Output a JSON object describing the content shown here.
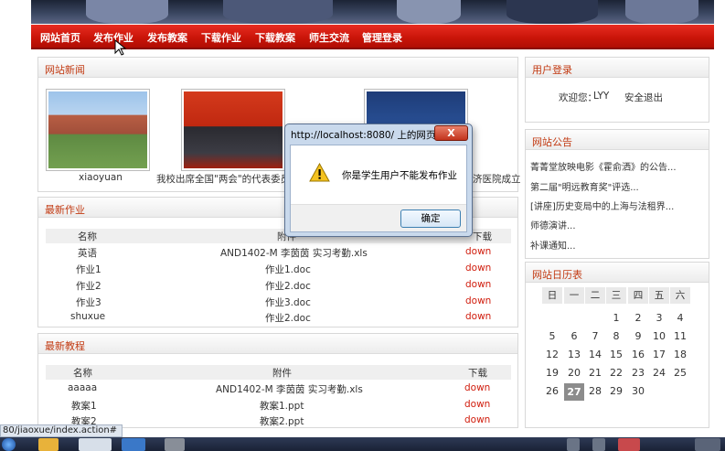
{
  "nav": [
    "网站首页",
    "发布作业",
    "发布教案",
    "下载作业",
    "下载教案",
    "师生交流",
    "管理登录"
  ],
  "news": {
    "title": "网站新闻",
    "captions": [
      "xiaoyuan",
      "我校出席全国\"两会\"的代表委员载",
      "济医院成立"
    ]
  },
  "homework": {
    "title": "最新作业",
    "headers": [
      "名称",
      "附件",
      "下载"
    ],
    "rows": [
      [
        "英语",
        "AND1402-M 李茵茵 实习考勤.xls",
        "down"
      ],
      [
        "作业1",
        "作业1.doc",
        "down"
      ],
      [
        "作业2",
        "作业2.doc",
        "down"
      ],
      [
        "作业3",
        "作业3.doc",
        "down"
      ],
      [
        "shuxue",
        "作业2.doc",
        "down"
      ]
    ]
  },
  "lessons": {
    "title": "最新教程",
    "headers": [
      "名称",
      "附件",
      "下载"
    ],
    "rows": [
      [
        "aaaaa",
        "AND1402-M 李茵茵 实习考勤.xls",
        "down"
      ],
      [
        "教案1",
        "教案1.ppt",
        "down"
      ],
      [
        "教案2",
        "教案2.ppt",
        "down"
      ]
    ]
  },
  "login": {
    "title": "用户登录",
    "welcome": "欢迎您：",
    "user": "LYY",
    "logout": "安全退出"
  },
  "notices": {
    "title": "网站公告",
    "items": [
      "菁菁堂放映电影《霍俞洒》的公告...",
      "第二届\"明远教育奖\"评选...",
      "[讲座]历史变局中的上海与法租界...",
      "师德演讲...",
      "补课通知..."
    ]
  },
  "calendar": {
    "title": "网站日历表",
    "weekdays": [
      "日",
      "一",
      "二",
      "三",
      "四",
      "五",
      "六"
    ],
    "weeks": [
      [
        "",
        "",
        "",
        "",
        "1",
        "2",
        "3",
        "4"
      ],
      [
        "5",
        "6",
        "7",
        "8",
        "9",
        "10",
        "11"
      ],
      [
        "12",
        "13",
        "14",
        "15",
        "16",
        "17",
        "18"
      ],
      [
        "19",
        "20",
        "21",
        "22",
        "23",
        "24",
        "25"
      ],
      [
        "26",
        "27",
        "28",
        "29",
        "30"
      ]
    ],
    "today": "27"
  },
  "dialog": {
    "title": "http://localhost:8080/ 上的网页显...",
    "close": "X",
    "message": "你是学生用户不能发布作业",
    "ok": "确定"
  },
  "status_url": "80/jiaoxue/index.action#"
}
